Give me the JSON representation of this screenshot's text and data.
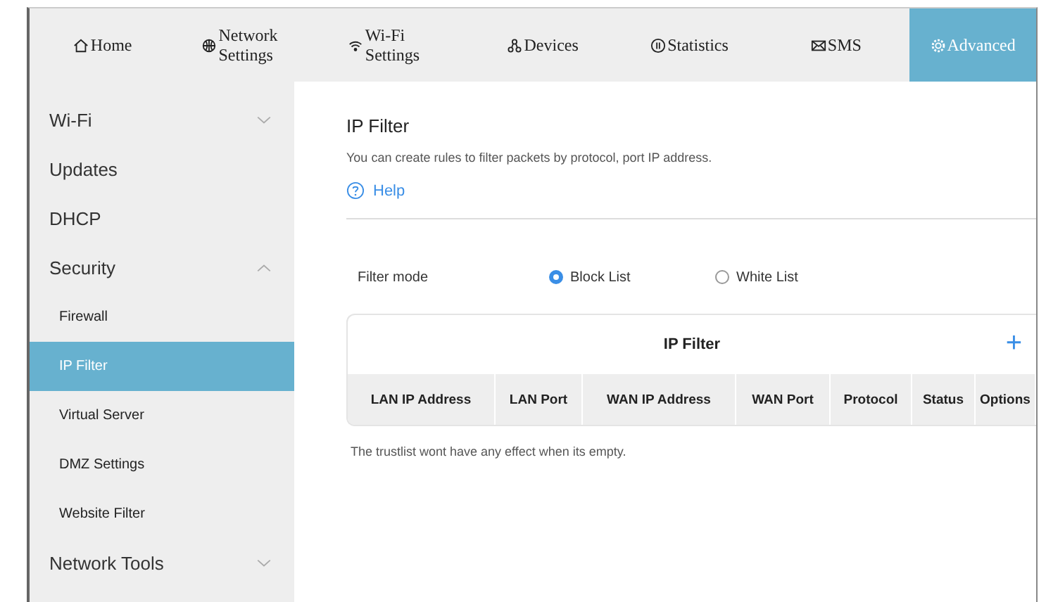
{
  "nav": [
    {
      "label": "Home",
      "selected": false
    },
    {
      "label": "Network Settings",
      "selected": false
    },
    {
      "label": "Wi-Fi Settings",
      "selected": false
    },
    {
      "label": "Devices",
      "selected": false
    },
    {
      "label": "Statistics",
      "selected": false
    },
    {
      "label": "SMS",
      "selected": false
    },
    {
      "label": "Advanced",
      "selected": true
    }
  ],
  "sidebar": {
    "items": [
      {
        "label": "Wi-Fi",
        "expanded": false,
        "selected": false
      },
      {
        "label": "Updates",
        "selected": false
      },
      {
        "label": "DHCP",
        "selected": false
      },
      {
        "label": "Security",
        "expanded": true,
        "selected": false,
        "children": [
          {
            "label": "Firewall",
            "selected": false
          },
          {
            "label": "IP Filter",
            "selected": true
          },
          {
            "label": "Virtual Server",
            "selected": false
          },
          {
            "label": "DMZ Settings",
            "selected": false
          },
          {
            "label": "Website Filter",
            "selected": false
          }
        ]
      },
      {
        "label": "Network Tools",
        "expanded": false,
        "selected": false
      }
    ]
  },
  "page": {
    "title": "IP Filter",
    "description": "You can create rules to filter packets by protocol, port IP address.",
    "help": "Help"
  },
  "filter_mode": {
    "label": "Filter mode",
    "options": [
      {
        "label": "Block List",
        "selected": true
      },
      {
        "label": "White List",
        "selected": false
      }
    ]
  },
  "table": {
    "title": "IP Filter",
    "add": "+",
    "columns": [
      "LAN IP Address",
      "LAN Port",
      "WAN IP Address",
      "WAN Port",
      "Protocol",
      "Status",
      "Options"
    ]
  },
  "note": "The trustlist wont have any effect when its empty."
}
